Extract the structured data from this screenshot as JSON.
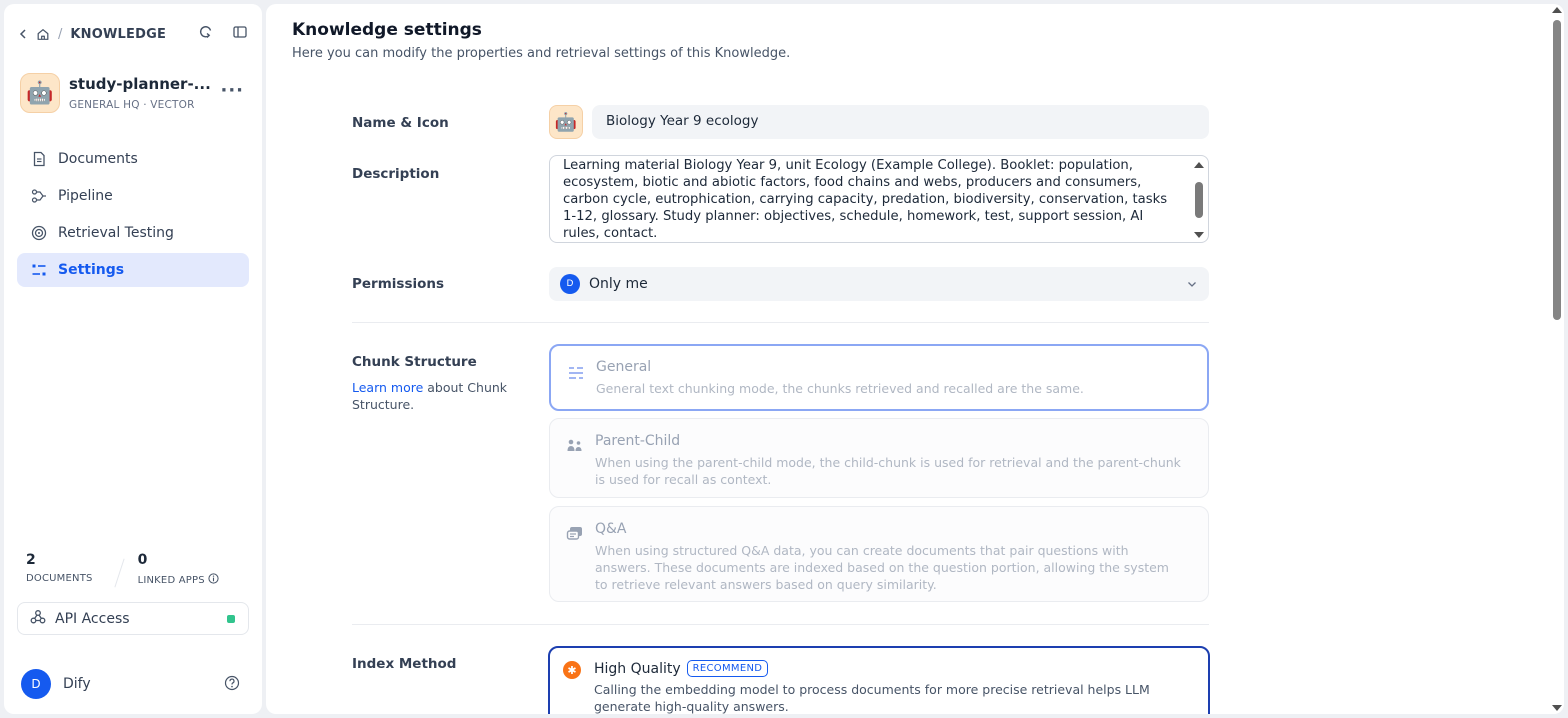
{
  "breadcrumb": {
    "section": "KNOWLEDGE"
  },
  "dataset": {
    "name": "study-planner-...",
    "meta": "GENERAL   HQ · VECTOR",
    "avatar_emoji": "🤖"
  },
  "nav": {
    "items": [
      {
        "label": "Documents",
        "icon": "document-icon"
      },
      {
        "label": "Pipeline",
        "icon": "pipeline-icon"
      },
      {
        "label": "Retrieval Testing",
        "icon": "target-icon"
      },
      {
        "label": "Settings",
        "icon": "settings-sliders-icon",
        "active": true
      }
    ]
  },
  "stats": {
    "documents": {
      "value": "2",
      "label": "DOCUMENTS"
    },
    "linked_apps": {
      "value": "0",
      "label": "LINKED APPS"
    }
  },
  "api_access": {
    "label": "API Access",
    "status_color": "#31c48d"
  },
  "user": {
    "initial": "D",
    "name": "Dify"
  },
  "settings": {
    "title": "Knowledge settings",
    "subtitle": "Here you can modify the properties and retrieval settings of this Knowledge.",
    "name_icon_label": "Name & Icon",
    "name_value": "Biology Year 9 ecology",
    "description_label": "Description",
    "description_value": "Learning material Biology Year 9, unit Ecology (Example College). Booklet: population, ecosystem, biotic and abiotic factors, food chains and webs, producers and consumers, carbon cycle, eutrophication, carrying capacity, predation, biodiversity, conservation, tasks 1-12, glossary. Study planner: objectives, schedule, homework, test, support session, AI rules, contact.",
    "permissions_label": "Permissions",
    "permissions_value": "Only me",
    "permissions_initial": "D",
    "chunk_label": "Chunk Structure",
    "chunk_learn_link": "Learn more",
    "chunk_learn_rest": " about Chunk Structure.",
    "chunk_options": [
      {
        "title": "General",
        "desc": "General text chunking mode, the chunks retrieved and recalled are the same.",
        "selected": true
      },
      {
        "title": "Parent-Child",
        "desc": "When using the parent-child mode, the child-chunk is used for retrieval and the parent-chunk is used for recall as context."
      },
      {
        "title": "Q&A",
        "desc": "When using structured Q&A data, you can create documents that pair questions with answers. These documents are indexed based on the question portion, allowing the system to retrieve relevant answers based on query similarity."
      }
    ],
    "index_label": "Index Method",
    "index_option": {
      "title": "High Quality",
      "badge": "RECOMMEND",
      "desc": "Calling the embedding model to process documents for more precise retrieval helps LLM generate high-quality answers."
    }
  },
  "colors": {
    "accent": "#155aef",
    "active_bg": "#e3e9fd",
    "hq_border": "#1d3fb0"
  }
}
